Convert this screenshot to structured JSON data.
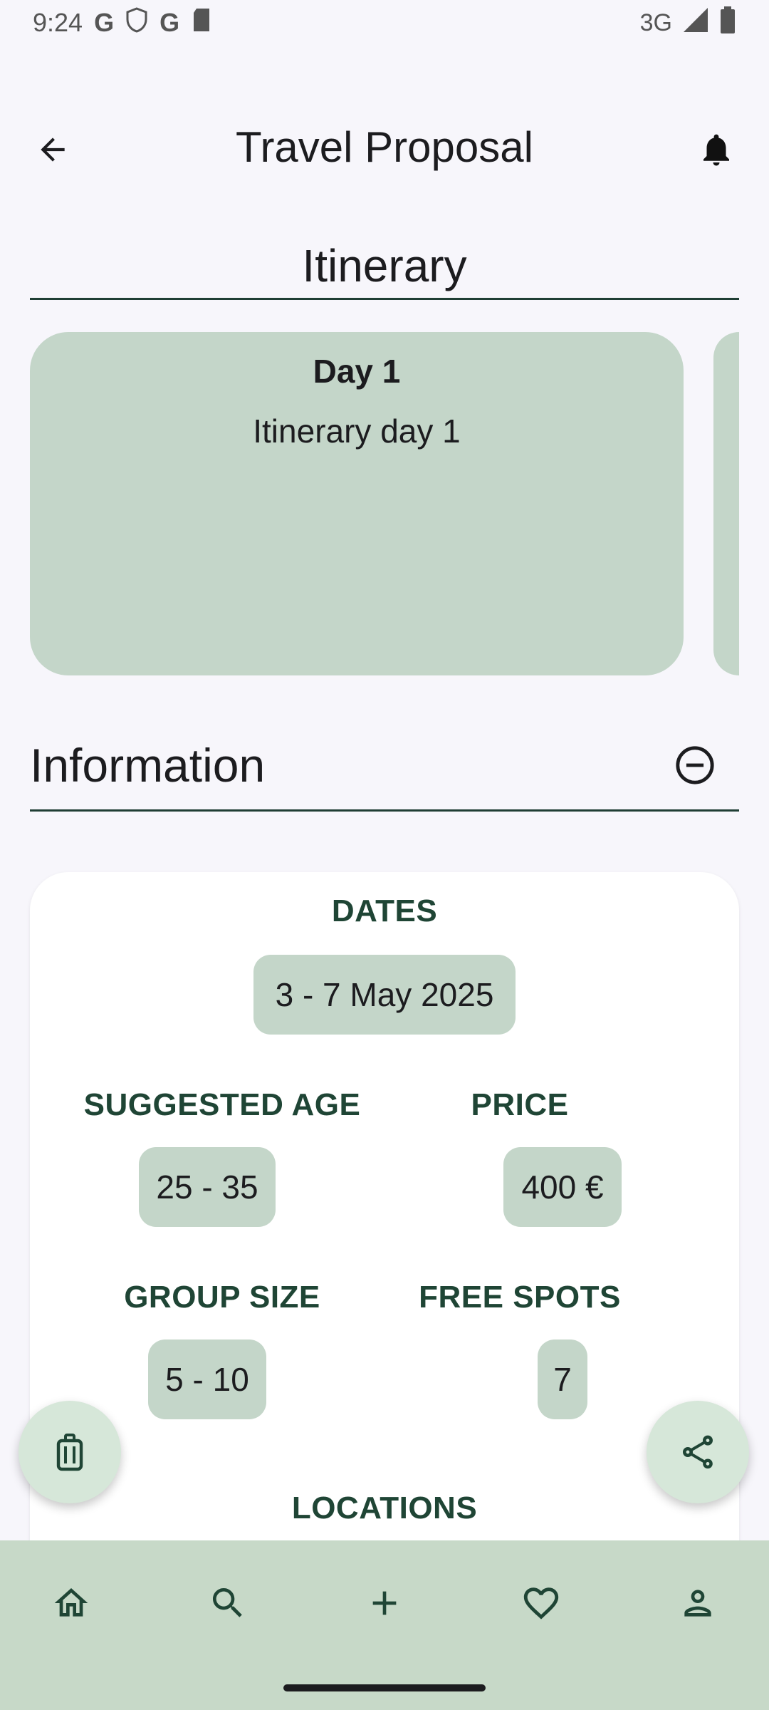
{
  "status_bar": {
    "time": "9:24",
    "left_icons": [
      "google-g-icon",
      "shield-icon",
      "google-g-icon",
      "sd-card-icon"
    ],
    "network": "3G",
    "right_icons": [
      "signal-icon",
      "battery-icon"
    ]
  },
  "app_bar": {
    "title": "Travel Proposal",
    "back_icon": "arrow-back-icon",
    "notification_icon": "bell-icon"
  },
  "itinerary": {
    "title": "Itinerary",
    "days": [
      {
        "title": "Day 1",
        "description": "Itinerary day 1"
      }
    ]
  },
  "information": {
    "title": "Information",
    "collapse_icon": "minus-circle-icon",
    "dates_label": "DATES",
    "dates_value": "3 - 7 May 2025",
    "age_label": "SUGGESTED AGE",
    "age_value": "25 - 35",
    "price_label": "PRICE",
    "price_value": "400 €",
    "group_label": "GROUP SIZE",
    "group_value": "5 - 10",
    "spots_label": "FREE SPOTS",
    "spots_value": "7",
    "locations_label": "LOCATIONS"
  },
  "fabs": {
    "left_icon": "luggage-icon",
    "right_icon": "share-icon"
  },
  "bottom_nav": {
    "items": [
      "home-icon",
      "search-icon",
      "add-icon",
      "heart-icon",
      "profile-icon"
    ]
  },
  "colors": {
    "accent_green": "#c4d6c9",
    "label_green": "#1f4535",
    "nav_background": "#c7d9c8",
    "background": "#f7f6fb"
  }
}
